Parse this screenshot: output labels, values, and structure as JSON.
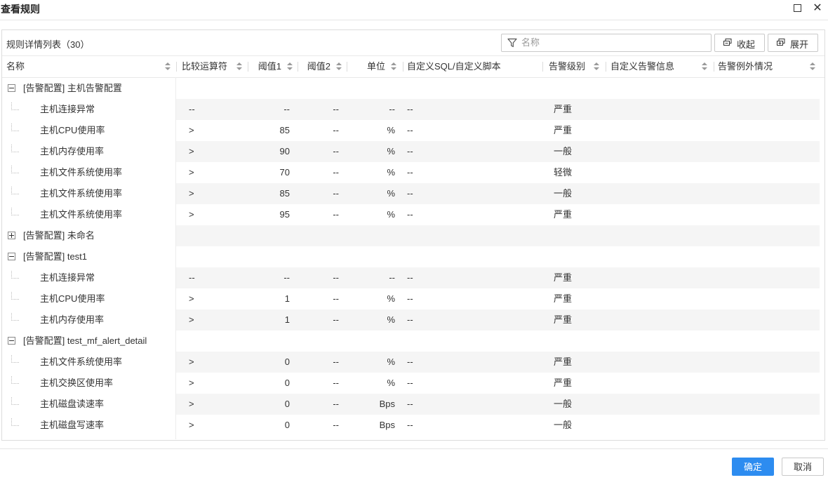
{
  "dialog": {
    "title": "查看规则",
    "maximize_icon": "maximize-icon",
    "close_icon": "close-icon",
    "close_glyph": "✕"
  },
  "toolbar": {
    "list_title": "规则详情列表（30）",
    "filter_placeholder": "名称",
    "filter_icon": "filter-icon",
    "collapse_label": "收起",
    "expand_label": "展开",
    "collapse_icon": "collapse-icon",
    "expand_icon": "expand-icon"
  },
  "columns": {
    "name": "名称",
    "operator": "比较运算符",
    "threshold1": "阈值1",
    "threshold2": "阈值2",
    "unit": "单位",
    "custom_sql": "自定义SQL/自定义脚本",
    "level": "告警级别",
    "custom_message": "自定义告警信息",
    "exception": "告警例外情况"
  },
  "groups": [
    {
      "label": "[告警配置] 主机告警配置",
      "expanded": true,
      "rows": [
        {
          "name": "主机连接异常",
          "op": "--",
          "t1": "--",
          "t2": "--",
          "unit": "--",
          "sql": "--",
          "level": "严重"
        },
        {
          "name": "主机CPU使用率",
          "op": ">",
          "t1": "85",
          "t2": "--",
          "unit": "%",
          "sql": "--",
          "level": "严重"
        },
        {
          "name": "主机内存使用率",
          "op": ">",
          "t1": "90",
          "t2": "--",
          "unit": "%",
          "sql": "--",
          "level": "一般"
        },
        {
          "name": "主机文件系统使用率",
          "op": ">",
          "t1": "70",
          "t2": "--",
          "unit": "%",
          "sql": "--",
          "level": "轻微"
        },
        {
          "name": "主机文件系统使用率",
          "op": ">",
          "t1": "85",
          "t2": "--",
          "unit": "%",
          "sql": "--",
          "level": "一般"
        },
        {
          "name": "主机文件系统使用率",
          "op": ">",
          "t1": "95",
          "t2": "--",
          "unit": "%",
          "sql": "--",
          "level": "严重"
        }
      ]
    },
    {
      "label": "[告警配置] 未命名",
      "expanded": false,
      "rows": []
    },
    {
      "label": "[告警配置] test1",
      "expanded": true,
      "rows": [
        {
          "name": "主机连接异常",
          "op": "--",
          "t1": "--",
          "t2": "--",
          "unit": "--",
          "sql": "--",
          "level": "严重"
        },
        {
          "name": "主机CPU使用率",
          "op": ">",
          "t1": "1",
          "t2": "--",
          "unit": "%",
          "sql": "--",
          "level": "严重"
        },
        {
          "name": "主机内存使用率",
          "op": ">",
          "t1": "1",
          "t2": "--",
          "unit": "%",
          "sql": "--",
          "level": "严重"
        }
      ]
    },
    {
      "label": "[告警配置] test_mf_alert_detail",
      "expanded": true,
      "rows": [
        {
          "name": "主机文件系统使用率",
          "op": ">",
          "t1": "0",
          "t2": "--",
          "unit": "%",
          "sql": "--",
          "level": "严重"
        },
        {
          "name": "主机交换区使用率",
          "op": ">",
          "t1": "0",
          "t2": "--",
          "unit": "%",
          "sql": "--",
          "level": "严重"
        },
        {
          "name": "主机磁盘读速率",
          "op": ">",
          "t1": "0",
          "t2": "--",
          "unit": "Bps",
          "sql": "--",
          "level": "一般"
        },
        {
          "name": "主机磁盘写速率",
          "op": ">",
          "t1": "0",
          "t2": "--",
          "unit": "Bps",
          "sql": "--",
          "level": "一般"
        }
      ]
    }
  ],
  "footer": {
    "ok_label": "确定",
    "cancel_label": "取消",
    "ok_color": "#2d8cf0"
  }
}
